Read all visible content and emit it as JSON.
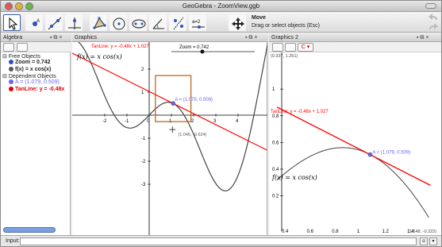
{
  "window": {
    "title": "GeoGebra - ZoomView.ggb"
  },
  "toolbar": {
    "active_tool": "Move",
    "tool_name": "Move",
    "tool_help": "Drag or select objects (Esc)",
    "tools": [
      "move-tool",
      "point-tool",
      "line-tool",
      "perpendicular-tool",
      "polygon-tool",
      "circle-tool",
      "conic-tool",
      "angle-tool",
      "reflect-tool",
      "slider-tool",
      "move-graphics-tool"
    ],
    "slider_glyph": "a=2"
  },
  "algebra": {
    "header": "Algebra",
    "free_objects_label": "Free Objects",
    "zoom_item": "Zoom = 0.742",
    "fx_item": "f(x) = x cos(x)",
    "dependent_objects_label": "Dependent Objects",
    "a_item": "A = (1.079, 0.509)",
    "tanline_item": "TanLine: y = -0.48x"
  },
  "graphics": {
    "header": "Graphics",
    "tanline_label": "TanLine: y = -0.48x + 1.027",
    "fx_label": "f(x) = x cos(x)",
    "zoom_label": "Zoom = 0.742",
    "point_label": "A = (1.079, 0.509)",
    "cursor_coords": "(1.045, -0.624)",
    "x_ticks": [
      "-2",
      "-1",
      "0",
      "1",
      "2",
      "3",
      "4"
    ],
    "y_ticks": [
      "2",
      "1",
      "-1",
      "-2",
      "-3"
    ],
    "colors": {
      "curve": "#444444",
      "tangent": "#ff0000",
      "point": "#6666ee",
      "zoom_box": "#c05a10"
    }
  },
  "graphics2": {
    "header": "Graphics 2",
    "corner_top": "(0.337, 1.251)",
    "corner_bottom": "(1.548, -0.222)",
    "tanline_label": "TanLine: y = -0.48x + 1.027",
    "point_label": "A = (1.079, 0.509)",
    "fx_label": "f(x) = x cos(x)",
    "y_ticks": [
      "1",
      "0.8",
      "0.6",
      "0.4",
      "0.2"
    ],
    "x_ticks": [
      "0.4",
      "0.6",
      "0.8",
      "1",
      "1.2",
      "1.4"
    ]
  },
  "inputbar": {
    "label": "Input:"
  }
}
